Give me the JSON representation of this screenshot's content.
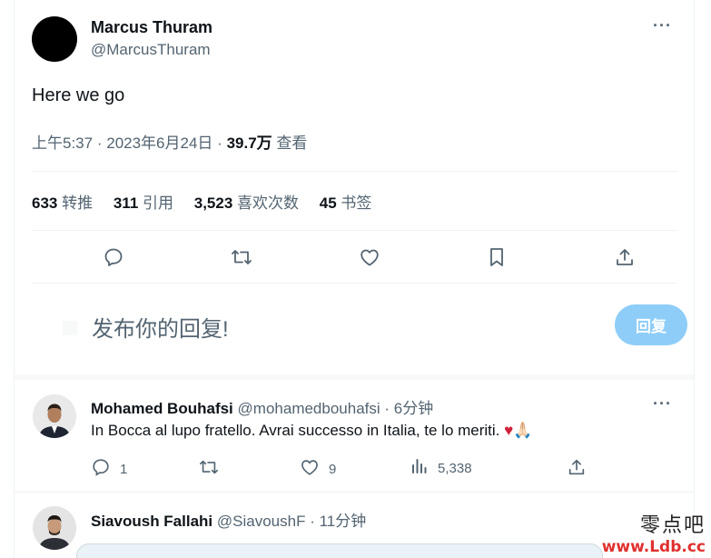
{
  "main_tweet": {
    "author_name": "Marcus Thuram",
    "author_handle": "@MarcusThuram",
    "more_label": "···",
    "text": "Here we go",
    "time": "上午5:37",
    "date": "2023年6月24日",
    "dot": "·",
    "views_count": "39.7万",
    "views_label": "查看",
    "stats": {
      "retweets_count": "633",
      "retweets_label": "转推",
      "quotes_count": "311",
      "quotes_label": "引用",
      "likes_count": "3,523",
      "likes_label": "喜欢次数",
      "bookmarks_count": "45",
      "bookmarks_label": "书签"
    },
    "actions": [
      "reply-icon",
      "retweet-icon",
      "like-icon",
      "bookmark-icon",
      "share-icon"
    ]
  },
  "reply_box": {
    "placeholder": "发布你的回复!",
    "button_label": "回复"
  },
  "replies": [
    {
      "name": "Mohamed Bouhafsi",
      "handle": "@mohamedbouhafsi",
      "time": "· 6分钟",
      "more_label": "···",
      "text": "In Bocca al lupo fratello. Avrai successo in Italia, te lo meriti.",
      "emoji": "♥🙏🏻",
      "reply_count": "1",
      "retweet_count": "",
      "like_count": "9",
      "views_count": "5,338"
    },
    {
      "name": "Siavoush Fallahi",
      "handle": "@SiavoushF",
      "time": "· 11分钟"
    }
  ],
  "watermark": {
    "top": "零点吧",
    "bottom": "www.Ldb.cc"
  },
  "colors": {
    "text_primary": "#0f1419",
    "text_secondary": "#536471",
    "button_disabled": "#8ecdf8",
    "border": "#eff3f4",
    "heart": "#d1203a"
  }
}
